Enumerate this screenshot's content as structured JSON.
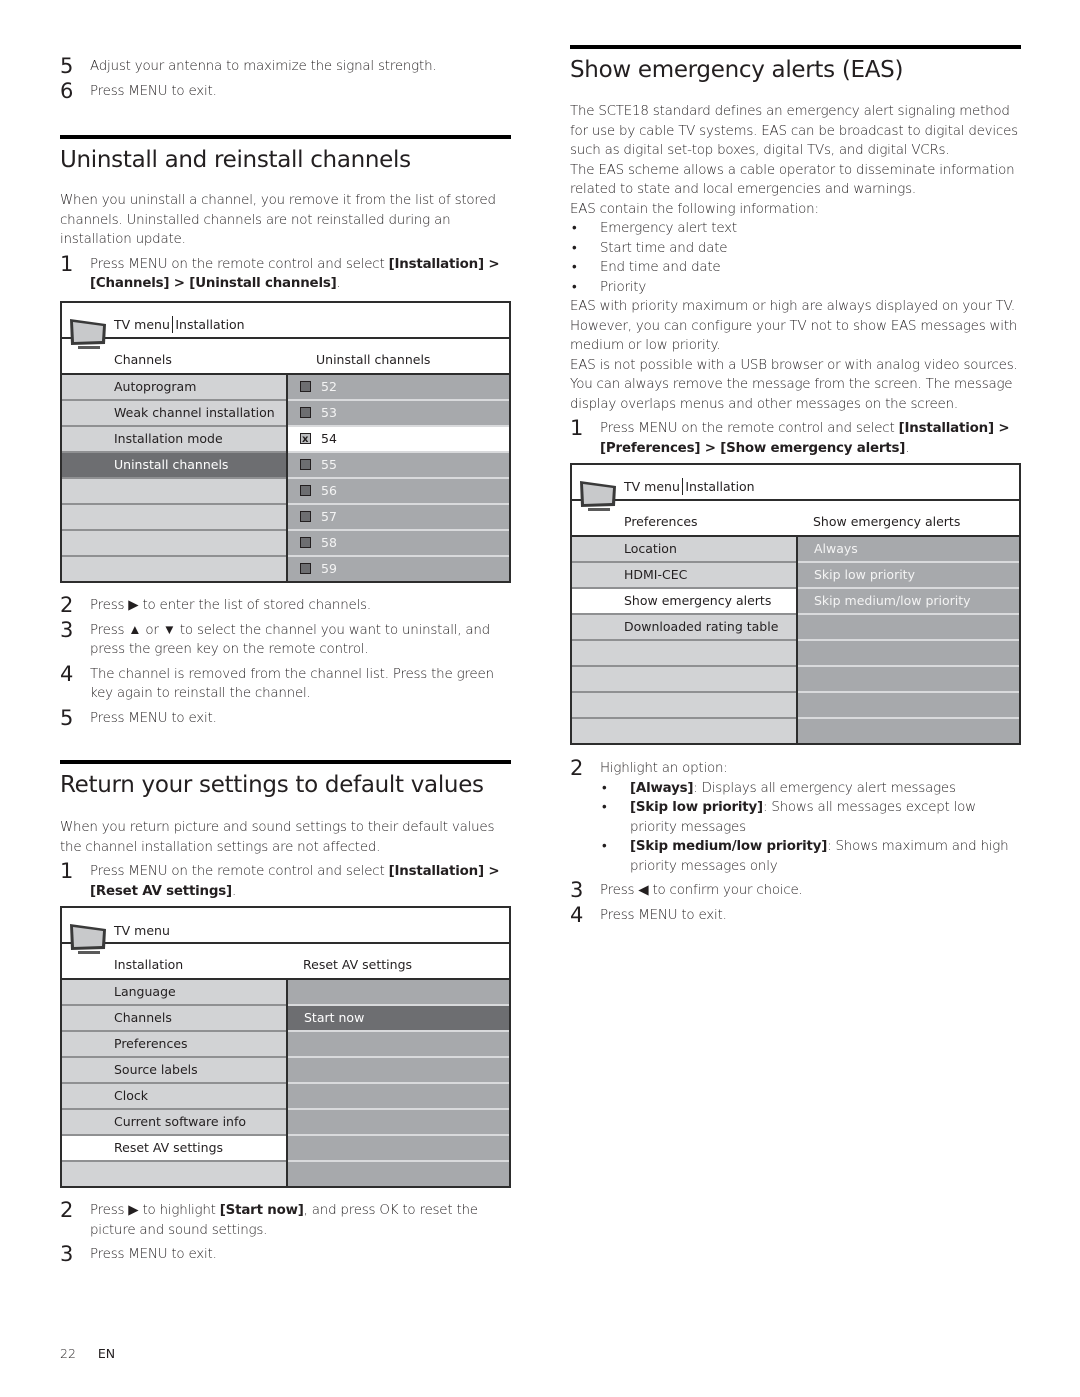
{
  "left": {
    "intro_steps": [
      {
        "num": "5",
        "text": "Adjust your antenna to maximize the signal strength."
      },
      {
        "num": "6",
        "text": "Press MENU to exit."
      }
    ],
    "uninstall": {
      "title": "Uninstall and reinstall channels",
      "intro": "When you uninstall a channel, you remove it from the list of stored channels. Uninstalled channels are not reinstalled during an installation update.",
      "step1": {
        "num": "1",
        "pre": "Press MENU on the remote control and select ",
        "path": "[Installation] > [Channels] > [Uninstall channels]",
        "post": "."
      },
      "menu": {
        "breadcrumb_root": "TV menu",
        "breadcrumb_sub": "Installation",
        "left_header": "Channels",
        "right_header": "Uninstall channels",
        "left_items": [
          "Autoprogram",
          "Weak channel installation",
          "Installation mode",
          "Uninstall channels",
          "",
          "",
          "",
          ""
        ],
        "selected_left": "Uninstall channels",
        "channels": [
          {
            "number": "52",
            "checked": false
          },
          {
            "number": "53",
            "checked": false
          },
          {
            "number": "54",
            "checked": true
          },
          {
            "number": "55",
            "checked": false
          },
          {
            "number": "56",
            "checked": false
          },
          {
            "number": "57",
            "checked": false
          },
          {
            "number": "58",
            "checked": false
          },
          {
            "number": "59",
            "checked": false
          }
        ]
      },
      "steps": [
        {
          "num": "2",
          "text": "Press ▶ to enter the list of stored channels."
        },
        {
          "num": "3",
          "text": "Press ▲ or ▼ to select the channel you want to uninstall, and press the green key on the remote control."
        },
        {
          "num": "4",
          "text": "The channel is removed from the channel list. Press the green key again to reinstall the channel."
        },
        {
          "num": "5",
          "text": "Press MENU to exit."
        }
      ]
    },
    "reset": {
      "title": "Return your settings to default values",
      "intro": "When you return picture and sound settings to their default values the channel installation settings are not affected.",
      "step1": {
        "num": "1",
        "pre": "Press MENU on the remote control and select ",
        "path": "[Installation] > [Reset AV settings]",
        "post": "."
      },
      "menu": {
        "breadcrumb_root": "TV menu",
        "left_header": "Installation",
        "right_header": "Reset AV settings",
        "left_items": [
          "Language",
          "Channels",
          "Preferences",
          "Source labels",
          "Clock",
          "Current software info",
          "Reset AV settings",
          ""
        ],
        "right_items": [
          "",
          "Start now",
          "",
          "",
          "",
          "",
          "",
          ""
        ]
      },
      "step2": {
        "num": "2",
        "pre": "Press ▶ to highlight ",
        "bold": "[Start now]",
        "post": ", and press OK to reset the picture and sound settings."
      },
      "step3": {
        "num": "3",
        "text": "Press MENU to exit."
      }
    }
  },
  "right": {
    "eas": {
      "title": "Show emergency alerts (EAS)",
      "para1": "The SCTE18 standard defines an emergency alert signaling method for use by cable TV systems. EAS can be broadcast to digital devices such as digital set-top boxes, digital TVs, and digital VCRs.",
      "para2": "The EAS scheme allows a cable operator to disseminate information related to state and local emergencies and warnings.",
      "para3": "EAS contain the following information:",
      "info_items": [
        "Emergency alert text",
        "Start time and date",
        "End time and date",
        "Priority"
      ],
      "para4": "EAS with priority maximum or high are always displayed on your TV. However, you can configure your TV not to show EAS messages with medium or low priority.",
      "para5": "EAS is not possible with a USB browser or with analog video sources. You can always remove the message from the screen. The message display overlaps menus and other messages on the screen.",
      "step1": {
        "num": "1",
        "pre": "Press MENU on the remote control and select ",
        "path": "[Installation] > [Preferences] > [Show emergency alerts]",
        "post": "."
      },
      "menu": {
        "breadcrumb_root": "TV menu",
        "breadcrumb_sub": "Installation",
        "left_header": "Preferences",
        "right_header": "Show emergency alerts",
        "left_items": [
          "Location",
          "HDMI-CEC",
          "Show emergency alerts",
          "Downloaded rating table",
          "",
          "",
          "",
          ""
        ],
        "right_items": [
          "Always",
          "Skip low priority",
          "Skip medium/low priority",
          "",
          "",
          "",
          "",
          ""
        ]
      },
      "step2": {
        "num": "2",
        "text": "Highlight an option:"
      },
      "options": [
        {
          "label": "[Always]",
          "desc": ": Displays all emergency alert messages"
        },
        {
          "label": "[Skip low priority]",
          "desc": ": Shows all messages except low priority messages"
        },
        {
          "label": "[Skip medium/low priority]",
          "desc": ": Shows maximum and high priority messages only"
        }
      ],
      "step3": {
        "num": "3",
        "text": "Press ◀ to confirm your choice."
      },
      "step4": {
        "num": "4",
        "text": "Press MENU to exit."
      }
    }
  },
  "footer": {
    "page": "22",
    "lang": "EN"
  }
}
